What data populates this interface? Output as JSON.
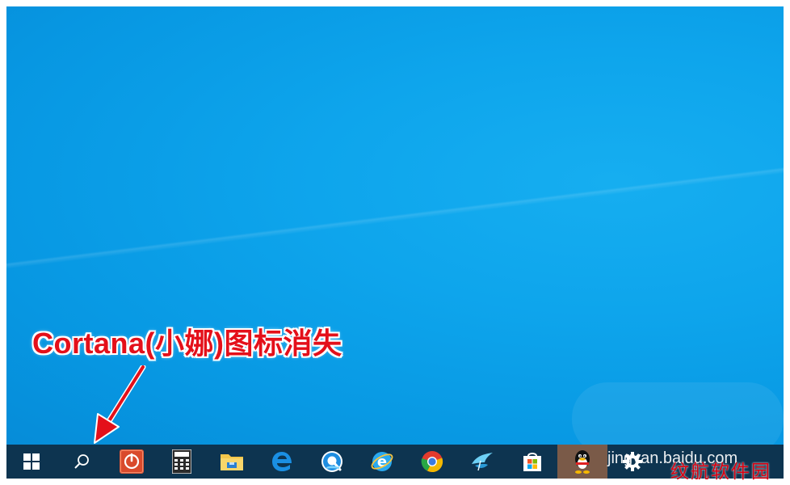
{
  "annotation": {
    "text": "Cortana(小娜)图标消失"
  },
  "taskbar": {
    "items": [
      {
        "name": "start-button",
        "icon": "windows-logo-icon"
      },
      {
        "name": "search-button",
        "icon": "search-icon"
      },
      {
        "name": "power-app-button",
        "icon": "power-icon"
      },
      {
        "name": "calculator-button",
        "icon": "calculator-icon"
      },
      {
        "name": "file-explorer-button",
        "icon": "folder-icon"
      },
      {
        "name": "edge-button",
        "icon": "edge-icon"
      },
      {
        "name": "browser-button",
        "icon": "q-browser-icon"
      },
      {
        "name": "ie-button",
        "icon": "ie-icon"
      },
      {
        "name": "chrome-button",
        "icon": "chrome-icon"
      },
      {
        "name": "bird-app-button",
        "icon": "bird-icon"
      },
      {
        "name": "store-button",
        "icon": "store-icon"
      },
      {
        "name": "qq-button",
        "icon": "qq-penguin-icon"
      },
      {
        "name": "settings-button",
        "icon": "gear-icon"
      }
    ]
  },
  "watermark": {
    "site": "jingyan.baidu.com",
    "label": "纹航软件园"
  },
  "colors": {
    "desktop": "#0ea5ec",
    "taskbar": "#0d3450",
    "annotation": "#e4101a",
    "active_item": "#7a5a48"
  }
}
